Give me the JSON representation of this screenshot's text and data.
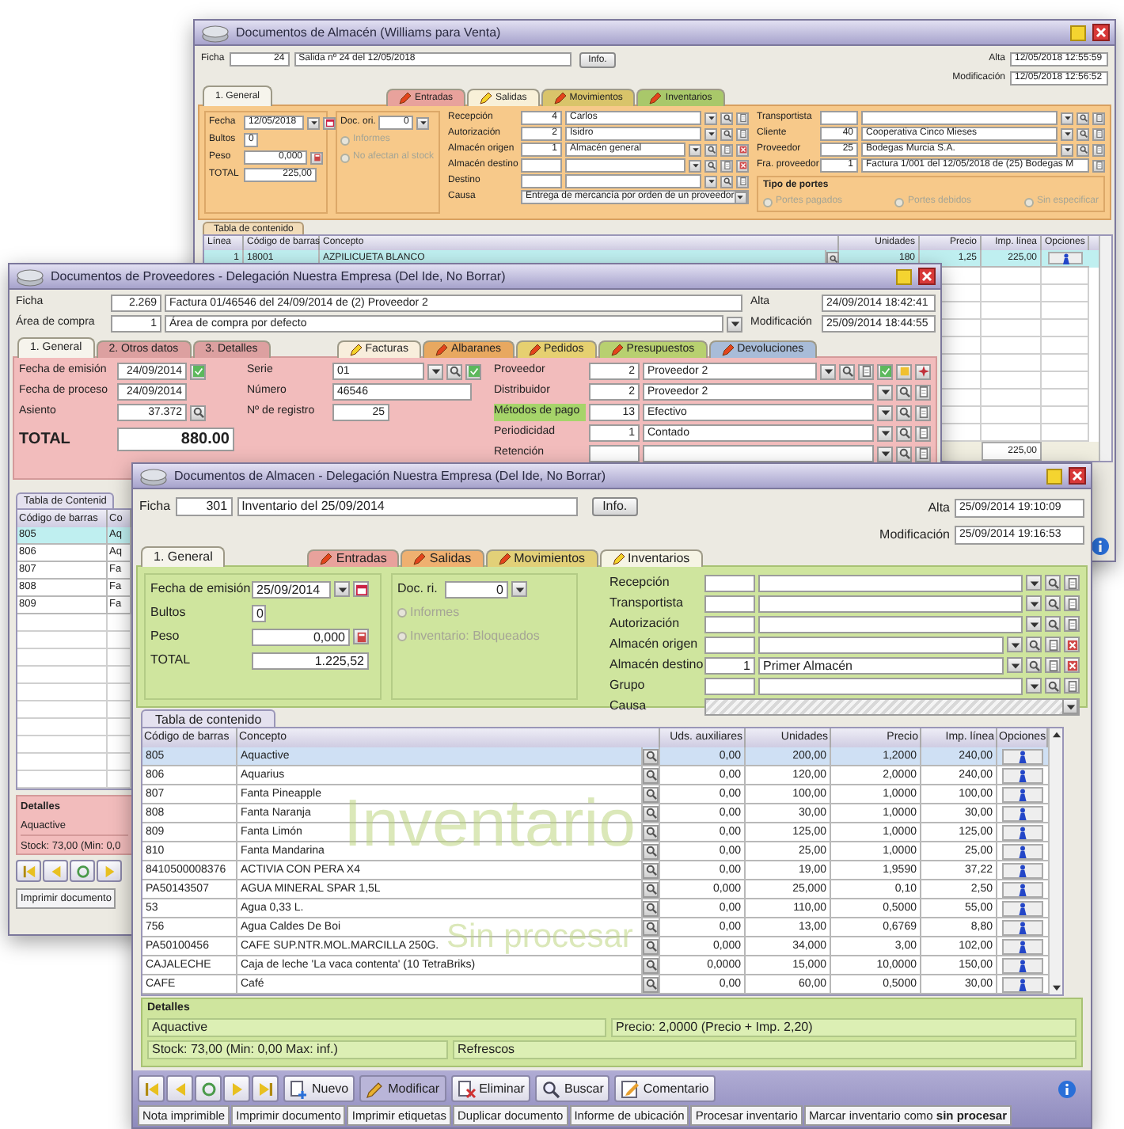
{
  "back_window": {
    "title": "Documentos de Almacén (Williams para Venta)",
    "record": {
      "label": "Ficha",
      "number": "24",
      "description": "Salida nº 24 del 12/05/2018"
    },
    "info_button": "Info.",
    "created": {
      "label": "Alta",
      "value": "12/05/2018 12:55:59"
    },
    "modified": {
      "label": "Modificación",
      "value": "12/05/2018 12:56:52"
    },
    "tabs": [
      {
        "label": "1. General",
        "kind": "page",
        "selected": true
      },
      {
        "label": "Entradas",
        "kind": "doc_type",
        "color": "#e8a29c",
        "current": false,
        "selected": false
      },
      {
        "label": "Salidas",
        "kind": "doc_type",
        "color": "#f8f0d8",
        "current": true,
        "selected": false
      },
      {
        "label": "Movimientos",
        "kind": "doc_type",
        "color": "#d9c46a",
        "current": false,
        "selected": false
      },
      {
        "label": "Inventarios",
        "kind": "doc_type",
        "color": "#a9c86a",
        "current": false,
        "selected": false
      }
    ],
    "fields": [
      {
        "label": "Fecha",
        "value": "12/05/2018",
        "kind": "date"
      },
      {
        "label": "Bultos",
        "value": "0",
        "kind": "short"
      },
      {
        "label": "Peso",
        "value": "0,000",
        "kind": "calc"
      },
      {
        "label": "TOTAL",
        "value": "225,00",
        "kind": "plain"
      }
    ],
    "doc_field": {
      "label": "Doc. ori.",
      "value": "0"
    },
    "options": [
      {
        "label": "Informes",
        "checked": false,
        "disabled": true
      },
      {
        "label": "No afectan al stock",
        "checked": false,
        "disabled": true
      }
    ],
    "lookups": [
      {
        "label": "Recepción",
        "code": "4",
        "value": "Carlos",
        "kind": "combo"
      },
      {
        "label": "Autorización",
        "code": "2",
        "value": "Isidro",
        "kind": "combo"
      },
      {
        "label": "Almacén origen",
        "code": "1",
        "value": "Almacén general",
        "kind": "combo_clear"
      },
      {
        "label": "Almacén destino",
        "kind": "combo_clear"
      },
      {
        "label": "Destino",
        "kind": "combo"
      }
    ],
    "cause": {
      "label": "Causa",
      "value": "Entrega de mercancía por orden de un proveedor"
    },
    "parties": [
      {
        "label": "Transportista",
        "kind": "combo"
      },
      {
        "label": "Cliente",
        "code": "40",
        "value": "Cooperativa Cinco Mieses",
        "kind": "combo"
      },
      {
        "label": "Proveedor",
        "code": "25",
        "value": "Bodegas Murcia S.A.",
        "kind": "combo"
      },
      {
        "label": "Fra. proveedor",
        "code": "1",
        "value": "Factura 1/001 del 12/05/2018 de (25) Bodegas M",
        "kind": "link"
      }
    ],
    "freight": {
      "title": "Tipo de portes",
      "options": [
        {
          "label": "Portes pagados",
          "checked": false,
          "disabled": true
        },
        {
          "label": "Portes debidos",
          "checked": false,
          "disabled": true
        },
        {
          "label": "Sin especificar",
          "checked": false,
          "disabled": true
        }
      ]
    },
    "table": {
      "tab": "Tabla de contenido",
      "columns": [
        "Línea",
        "Código de barras",
        "Concepto",
        "Unidades",
        "Precio",
        "Imp. línea",
        "Opciones"
      ],
      "rows": [
        {
          "cells": [
            "1",
            "18001",
            "AZPILICUETA BLANCO",
            "180",
            "1,25",
            "225,00"
          ],
          "selected": true
        }
      ],
      "total": "225,00"
    }
  },
  "middle_window": {
    "title": "Documentos de Proveedores - Delegación Nuestra Empresa (Del Ide, No Borrar)",
    "record": {
      "label": "Ficha",
      "number": "2.269",
      "description": "Factura 01/46546 del 24/09/2014 de (2) Proveedor 2"
    },
    "area": {
      "label": "Área de compra",
      "code": "1",
      "value": "Área de compra por defecto"
    },
    "created": {
      "label": "Alta",
      "value": "24/09/2014 18:42:41"
    },
    "modified": {
      "label": "Modificación",
      "value": "25/09/2014 18:44:55"
    },
    "tabs": [
      {
        "label": "1. General",
        "kind": "page",
        "selected": true
      },
      {
        "label": "2. Otros datos",
        "kind": "page",
        "selected": false
      },
      {
        "label": "3. Detalles",
        "kind": "page",
        "selected": false
      },
      {
        "label": "Facturas",
        "kind": "doc_type",
        "color": "#f8eedc",
        "current": true,
        "selected": false
      },
      {
        "label": "Albaranes",
        "kind": "doc_type",
        "color": "#e8a860",
        "current": false,
        "selected": false
      },
      {
        "label": "Pedidos",
        "kind": "doc_type",
        "color": "#e6d070",
        "current": false,
        "selected": false
      },
      {
        "label": "Presupuestos",
        "kind": "doc_type",
        "color": "#b8d070",
        "current": false,
        "selected": false
      },
      {
        "label": "Devoluciones",
        "kind": "doc_type",
        "color": "#a8bcd8",
        "current": false,
        "selected": false
      }
    ],
    "dates": [
      {
        "label": "Fecha de emisión",
        "value": "24/09/2014",
        "kind": "date_check"
      },
      {
        "label": "Fecha de proceso",
        "value": "24/09/2014",
        "kind": "date"
      },
      {
        "label": "Asiento",
        "value": "37.372",
        "kind": "lookup"
      }
    ],
    "total": {
      "label": "TOTAL",
      "value": "880.00"
    },
    "series": [
      {
        "label": "Serie",
        "value": "01",
        "kind": "combo_check"
      },
      {
        "label": "Número",
        "value": "46546",
        "kind": "text"
      },
      {
        "label": "Nº de registro",
        "value": "25",
        "kind": "number"
      }
    ],
    "parties": [
      {
        "label": "Proveedor",
        "code": "2",
        "value": "Proveedor 2",
        "highlighted": false,
        "kind": "combo_extra"
      },
      {
        "label": "Distribuidor",
        "code": "2",
        "value": "Proveedor 2",
        "highlighted": false,
        "kind": "combo"
      },
      {
        "label": "Métodos de pago",
        "code": "13",
        "value": "Efectivo",
        "highlighted": true,
        "kind": "combo"
      },
      {
        "label": "Periodicidad",
        "code": "1",
        "value": "Contado",
        "highlighted": false,
        "kind": "combo"
      },
      {
        "label": "Retención",
        "highlighted": false,
        "kind": "combo"
      }
    ],
    "table": {
      "tab": "Tabla de Contenid",
      "columns": [
        "Código de barras",
        "Co"
      ],
      "rows": [
        {
          "cells": [
            "805",
            "Aq"
          ],
          "selected": true
        },
        {
          "cells": [
            "806",
            "Aq"
          ],
          "selected": false
        },
        {
          "cells": [
            "807",
            "Fa"
          ],
          "selected": false
        },
        {
          "cells": [
            "808",
            "Fa"
          ],
          "selected": false
        },
        {
          "cells": [
            "809",
            "Fa"
          ],
          "selected": false
        }
      ]
    },
    "details": {
      "title": "Detalles",
      "item": "Aquactive",
      "stock": "Stock: 73,00 (Min: 0,0"
    },
    "print_button": "Imprimir documento"
  },
  "front_window": {
    "title": "Documentos de Almacen - Delegación Nuestra Empresa (Del Ide, No Borrar)",
    "record": {
      "label": "Ficha",
      "number": "301",
      "description": "Inventario del 25/09/2014"
    },
    "info_button": "Info.",
    "created": {
      "label": "Alta",
      "value": "25/09/2014 19:10:09"
    },
    "modified": {
      "label": "Modificación",
      "value": "25/09/2014 19:16:53"
    },
    "tabs": [
      {
        "label": "1. General",
        "kind": "page",
        "selected": true
      },
      {
        "label": "Entradas",
        "kind": "doc_type",
        "color": "#e8a29c",
        "current": false,
        "selected": false
      },
      {
        "label": "Salidas",
        "kind": "doc_type",
        "color": "#efb070",
        "current": false,
        "selected": false
      },
      {
        "label": "Movimientos",
        "kind": "doc_type",
        "color": "#e2d078",
        "current": false,
        "selected": false
      },
      {
        "label": "Inventarios",
        "kind": "doc_type",
        "color": "#f6f4e4",
        "current": true,
        "selected": false
      }
    ],
    "fields": [
      {
        "label": "Fecha de emisión",
        "value": "25/09/2014",
        "kind": "date"
      },
      {
        "label": "Bultos",
        "value": "0",
        "kind": "short"
      },
      {
        "label": "Peso",
        "value": "0,000",
        "kind": "calc"
      },
      {
        "label": "TOTAL",
        "value": "1.225,52",
        "kind": "plain"
      }
    ],
    "doc_field": {
      "label": "Doc. ri.",
      "value": "0"
    },
    "options": [
      {
        "label": "Informes",
        "checked": false,
        "disabled": true
      },
      {
        "label": "Inventario: Bloqueados",
        "checked": false,
        "disabled": true
      }
    ],
    "lookups": [
      {
        "label": "Recepción",
        "kind": "combo"
      },
      {
        "label": "Transportista",
        "kind": "combo"
      },
      {
        "label": "Autorización",
        "kind": "combo"
      },
      {
        "label": "Almacén origen",
        "kind": "combo_clear"
      },
      {
        "label": "Almacén destino",
        "code": "1",
        "value": "Primer Almacén",
        "kind": "combo_clear"
      },
      {
        "label": "Grupo",
        "kind": "combo"
      }
    ],
    "cause": {
      "label": "Causa"
    },
    "table": {
      "tab": "Tabla de contenido",
      "columns": [
        "Código de barras",
        "Concepto",
        "Uds. auxiliares",
        "Unidades",
        "Precio",
        "Imp. línea",
        "Opciones"
      ],
      "rows": [
        {
          "cells": [
            "805",
            "Aquactive",
            "0,00",
            "200,00",
            "1,2000",
            "240,00"
          ],
          "selected": true
        },
        {
          "cells": [
            "806",
            "Aquarius",
            "0,00",
            "120,00",
            "2,0000",
            "240,00"
          ],
          "selected": false
        },
        {
          "cells": [
            "807",
            "Fanta Pineapple",
            "0,00",
            "100,00",
            "1,0000",
            "100,00"
          ],
          "selected": false
        },
        {
          "cells": [
            "808",
            "Fanta Naranja",
            "0,00",
            "30,00",
            "1,0000",
            "30,00"
          ],
          "selected": false
        },
        {
          "cells": [
            "809",
            "Fanta Limón",
            "0,00",
            "125,00",
            "1,0000",
            "125,00"
          ],
          "selected": false
        },
        {
          "cells": [
            "810",
            "Fanta Mandarina",
            "0,00",
            "25,00",
            "1,0000",
            "25,00"
          ],
          "selected": false
        },
        {
          "cells": [
            "8410500008376",
            "ACTIVIA CON PERA X4",
            "0,00",
            "19,00",
            "1,9590",
            "37,22"
          ],
          "selected": false
        },
        {
          "cells": [
            "PA50143507",
            "AGUA MINERAL SPAR 1,5L",
            "0,000",
            "25,000",
            "0,10",
            "2,50"
          ],
          "selected": false
        },
        {
          "cells": [
            "53",
            "Agua 0,33 L.",
            "0,00",
            "110,00",
            "0,5000",
            "55,00"
          ],
          "selected": false
        },
        {
          "cells": [
            "756",
            "Agua Caldes De Boi",
            "0,00",
            "13,00",
            "0,6769",
            "8,80"
          ],
          "selected": false
        },
        {
          "cells": [
            "PA50100456",
            "CAFE SUP.NTR.MOL.MARCILLA 250G.",
            "0,000",
            "34,000",
            "3,00",
            "102,00"
          ],
          "selected": false
        },
        {
          "cells": [
            "CAJALECHE",
            "Caja de leche 'La vaca contenta' (10 TetraBriks)",
            "0,0000",
            "15,000",
            "10,0000",
            "150,00"
          ],
          "selected": false
        },
        {
          "cells": [
            "CAFE",
            "Café",
            "0,00",
            "60,00",
            "0,5000",
            "30,00"
          ],
          "selected": false
        }
      ]
    },
    "status_watermark": {
      "title": "Inventario",
      "subtitle": "Sin procesar"
    },
    "details": {
      "title": "Detalles",
      "item": "Aquactive",
      "price": "Precio: 2,0000 (Precio + Imp. 2,20)",
      "stock": "Stock: 73,00 (Min: 0,00 Max: inf.)",
      "family": "Refrescos"
    },
    "toolbar": [
      {
        "label": "Nuevo",
        "kind": "new",
        "selected": false
      },
      {
        "label": "Modificar",
        "kind": "edit",
        "selected": true
      },
      {
        "label": "Eliminar",
        "kind": "delete",
        "selected": false
      },
      {
        "label": "Buscar",
        "kind": "search",
        "selected": false
      },
      {
        "label": "Comentario",
        "kind": "comment",
        "selected": false
      }
    ],
    "actions": [
      "Nota imprimible",
      "Imprimir documento",
      "Imprimir etiquetas",
      "Duplicar documento",
      "Informe de ubicación",
      "Procesar inventario",
      "Marcar inventario como **sin procesar**"
    ]
  }
}
